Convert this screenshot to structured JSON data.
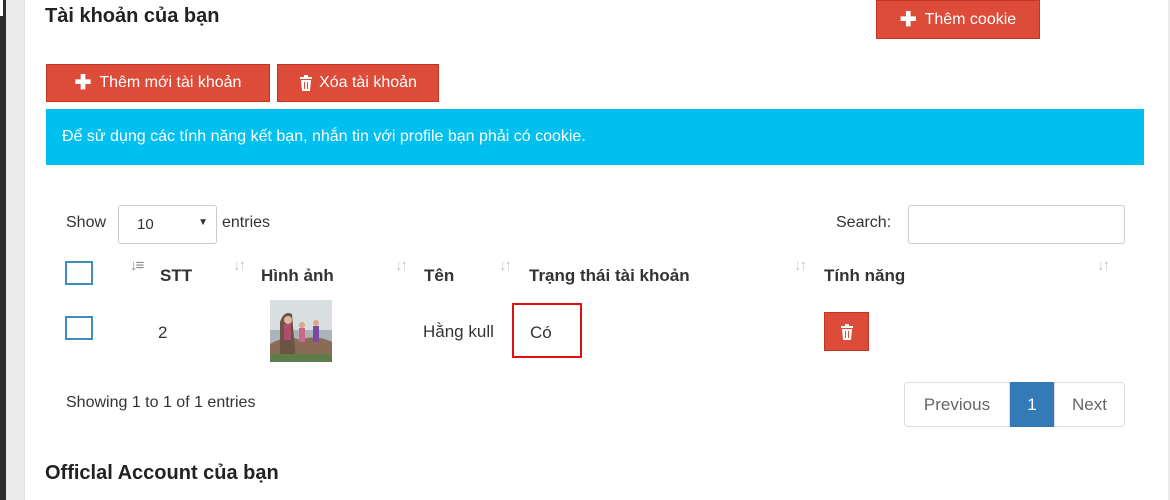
{
  "section_title": "Tài khoản của bạn",
  "toolbar": {
    "add_label": "Thêm mới tài khoản",
    "add_icon": "plus-icon",
    "delete_label": "Xóa tài khoản",
    "delete_icon": "trash-icon"
  },
  "alert_text": "Để sử dụng các tính năng kết bạn, nhắn tin với profile bạn phải có cookie.",
  "table_controls": {
    "show_label": "Show",
    "page_size_selected": "10",
    "entries_label": "entries",
    "search_label": "Search:",
    "search_value": ""
  },
  "table": {
    "columns": [
      "STT",
      "Hình ảnh",
      "Tên",
      "Trạng thái tài khoản",
      "Tính năng"
    ],
    "rows": [
      {
        "stt": "2",
        "image": "profile-photo",
        "name": "Hằng kull",
        "status": "Có",
        "actions": {
          "delete_icon": "trash-icon",
          "add_cookie_label": "Thêm cookie"
        }
      }
    ]
  },
  "pagination": {
    "info": "Showing 1 to 1 of 1 entries",
    "previous_label": "Previous",
    "current_page": "1",
    "next_label": "Next"
  },
  "next_section_title": "Officlal Account của bạn",
  "colors": {
    "danger": "#dd4b39",
    "info": "#00c0ef",
    "primary": "#337ab7",
    "checkbox_border": "#3c8dbc",
    "highlight": "#e01010"
  }
}
